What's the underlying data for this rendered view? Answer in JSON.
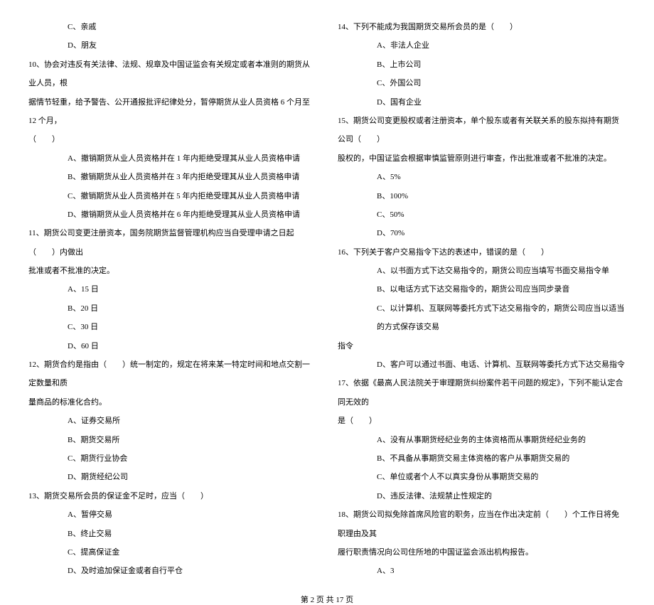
{
  "left": {
    "q9_c": "C、亲戚",
    "q9_d": "D、朋友",
    "q10_stem_a": "10、协会对违反有关法律、法规、规章及中国证监会有关规定或者本准则的期货从业人员，根",
    "q10_stem_b": "据情节轻重，给予警告、公开通报批评纪律处分，暂停期货从业人员资格 6 个月至 12 个月，",
    "q10_stem_c": "（　　）",
    "q10_a": "A、撤销期货从业人员资格并在 1 年内拒绝受理其从业人员资格申请",
    "q10_b": "B、撤销期货从业人员资格并在 3 年内拒绝受理其从业人员资格申请",
    "q10_c": "C、撤销期货从业人员资格并在 5 年内拒绝受理其从业人员资格申请",
    "q10_d": "D、撤销期货从业人员资格并在 6 年内拒绝受理其从业人员资格申请",
    "q11_stem_a": "11、期货公司变更注册资本，国务院期货监督管理机构应当自受理申请之日起（　　）内做出",
    "q11_stem_b": "批准或者不批准的决定。",
    "q11_a": "A、15 日",
    "q11_b": "B、20 日",
    "q11_c": "C、30 日",
    "q11_d": "D、60 日",
    "q12_stem_a": "12、期货合约是指由（　　）统一制定的，规定在将来某一特定时间和地点交割一定数量和质",
    "q12_stem_b": "量商品的标准化合约。",
    "q12_a": "A、证券交易所",
    "q12_b": "B、期货交易所",
    "q12_c": "C、期货行业协会",
    "q12_d": "D、期货经纪公司",
    "q13_stem": "13、期货交易所会员的保证金不足时，应当（　　）",
    "q13_a": "A、暂停交易",
    "q13_b": "B、终止交易",
    "q13_c": "C、提高保证金",
    "q13_d": "D、及时追加保证金或者自行平仓"
  },
  "right": {
    "q14_stem": "14、下列不能成为我国期货交易所会员的是（　　）",
    "q14_a": "A、非法人企业",
    "q14_b": "B、上市公司",
    "q14_c": "C、外国公司",
    "q14_d": "D、国有企业",
    "q15_stem_a": "15、期货公司变更股权或者注册资本，单个股东或者有关联关系的股东拟持有期货公司（　　）",
    "q15_stem_b": "股权的，中国证监会根据审慎监管原则进行审查，作出批准或者不批准的决定。",
    "q15_a": "A、5%",
    "q15_b": "B、100%",
    "q15_c": "C、50%",
    "q15_d": "D、70%",
    "q16_stem": "16、下列关于客户交易指令下达的表述中，错误的是（　　）",
    "q16_a": "A、以书面方式下达交易指令的，期货公司应当填写书面交易指令单",
    "q16_b": "B、以电话方式下达交易指令的，期货公司应当同步录音",
    "q16_c_a": "C、以计算机、互联网等委托方式下达交易指令的，期货公司应当以适当的方式保存该交易",
    "q16_c_b": "指令",
    "q16_d": "D、客户可以通过书面、电话、计算机、互联网等委托方式下达交易指令",
    "q17_stem_a": "17、依据《最高人民法院关于审理期货纠纷案件若干问题的规定》，下列不能认定合同无效的",
    "q17_stem_b": "是（　　）",
    "q17_a": "A、没有从事期货经纪业务的主体资格而从事期货经纪业务的",
    "q17_b": "B、不具备从事期货交易主体资格的客户从事期货交易的",
    "q17_c": "C、单位或者个人不以真实身份从事期货交易的",
    "q17_d": "D、违反法律、法规禁止性规定的",
    "q18_stem_a": "18、期货公司拟免除首席风险官的职务，应当在作出决定前（　　）个工作日将免职理由及其",
    "q18_stem_b": "履行职责情况向公司住所地的中国证监会派出机构报告。",
    "q18_a": "A、3"
  },
  "footer": "第 2 页 共 17 页"
}
